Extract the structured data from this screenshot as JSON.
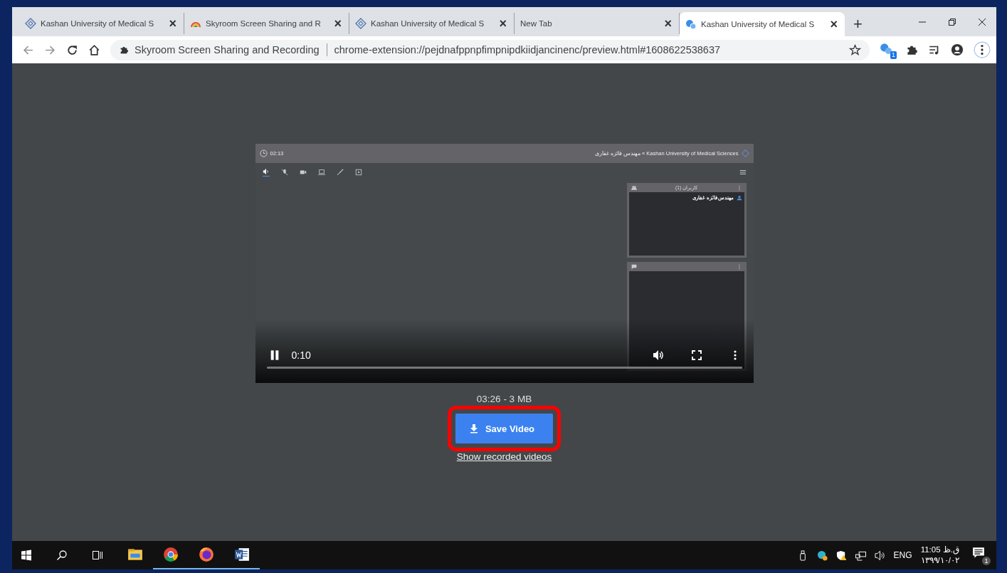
{
  "browser": {
    "tabs": [
      {
        "title": "Kashan University of Medical S",
        "kind": "diamond",
        "selected": false
      },
      {
        "title": "Skyroom Screen Sharing and R",
        "kind": "rainbow",
        "selected": false
      },
      {
        "title": "Kashan University of Medical S",
        "kind": "diamond",
        "selected": false
      },
      {
        "title": "New Tab",
        "kind": "none",
        "selected": false
      },
      {
        "title": "Kashan University of Medical S",
        "kind": "bubbles",
        "selected": true
      }
    ],
    "close_glyph": "×",
    "new_tab": "+",
    "address": {
      "site": "Skyroom Screen Sharing and Recording",
      "url": "chrome-extension://pejdnafppnpfimpnipdkiidjancinenc/preview.html#1608622538637"
    },
    "extension_badge": "1"
  },
  "video": {
    "header": {
      "time": "02:13",
      "breadcrumb": "Kashan University of Medical Sciences » مهندس فائزه غفاری"
    },
    "users_panel": {
      "title": "کاربران (1)",
      "users": [
        "مهندس فائزه غفاری"
      ]
    },
    "player": {
      "playing": true,
      "time": "0:10"
    }
  },
  "recording": {
    "info": "03:26 - 3 MB",
    "save_button": "Save Video",
    "highlighted": true,
    "link": "Show recorded videos"
  },
  "taskbar": {
    "apps": [
      {
        "kind": "explorer",
        "active": false
      },
      {
        "kind": "chrome",
        "active": true
      },
      {
        "kind": "firefox",
        "active": true
      },
      {
        "kind": "word",
        "active": true
      }
    ],
    "language": "ENG",
    "time": "11:05 ق.ظ",
    "date": "۱۳۹۹/۱۰/۰۲",
    "notification_count": "1"
  }
}
